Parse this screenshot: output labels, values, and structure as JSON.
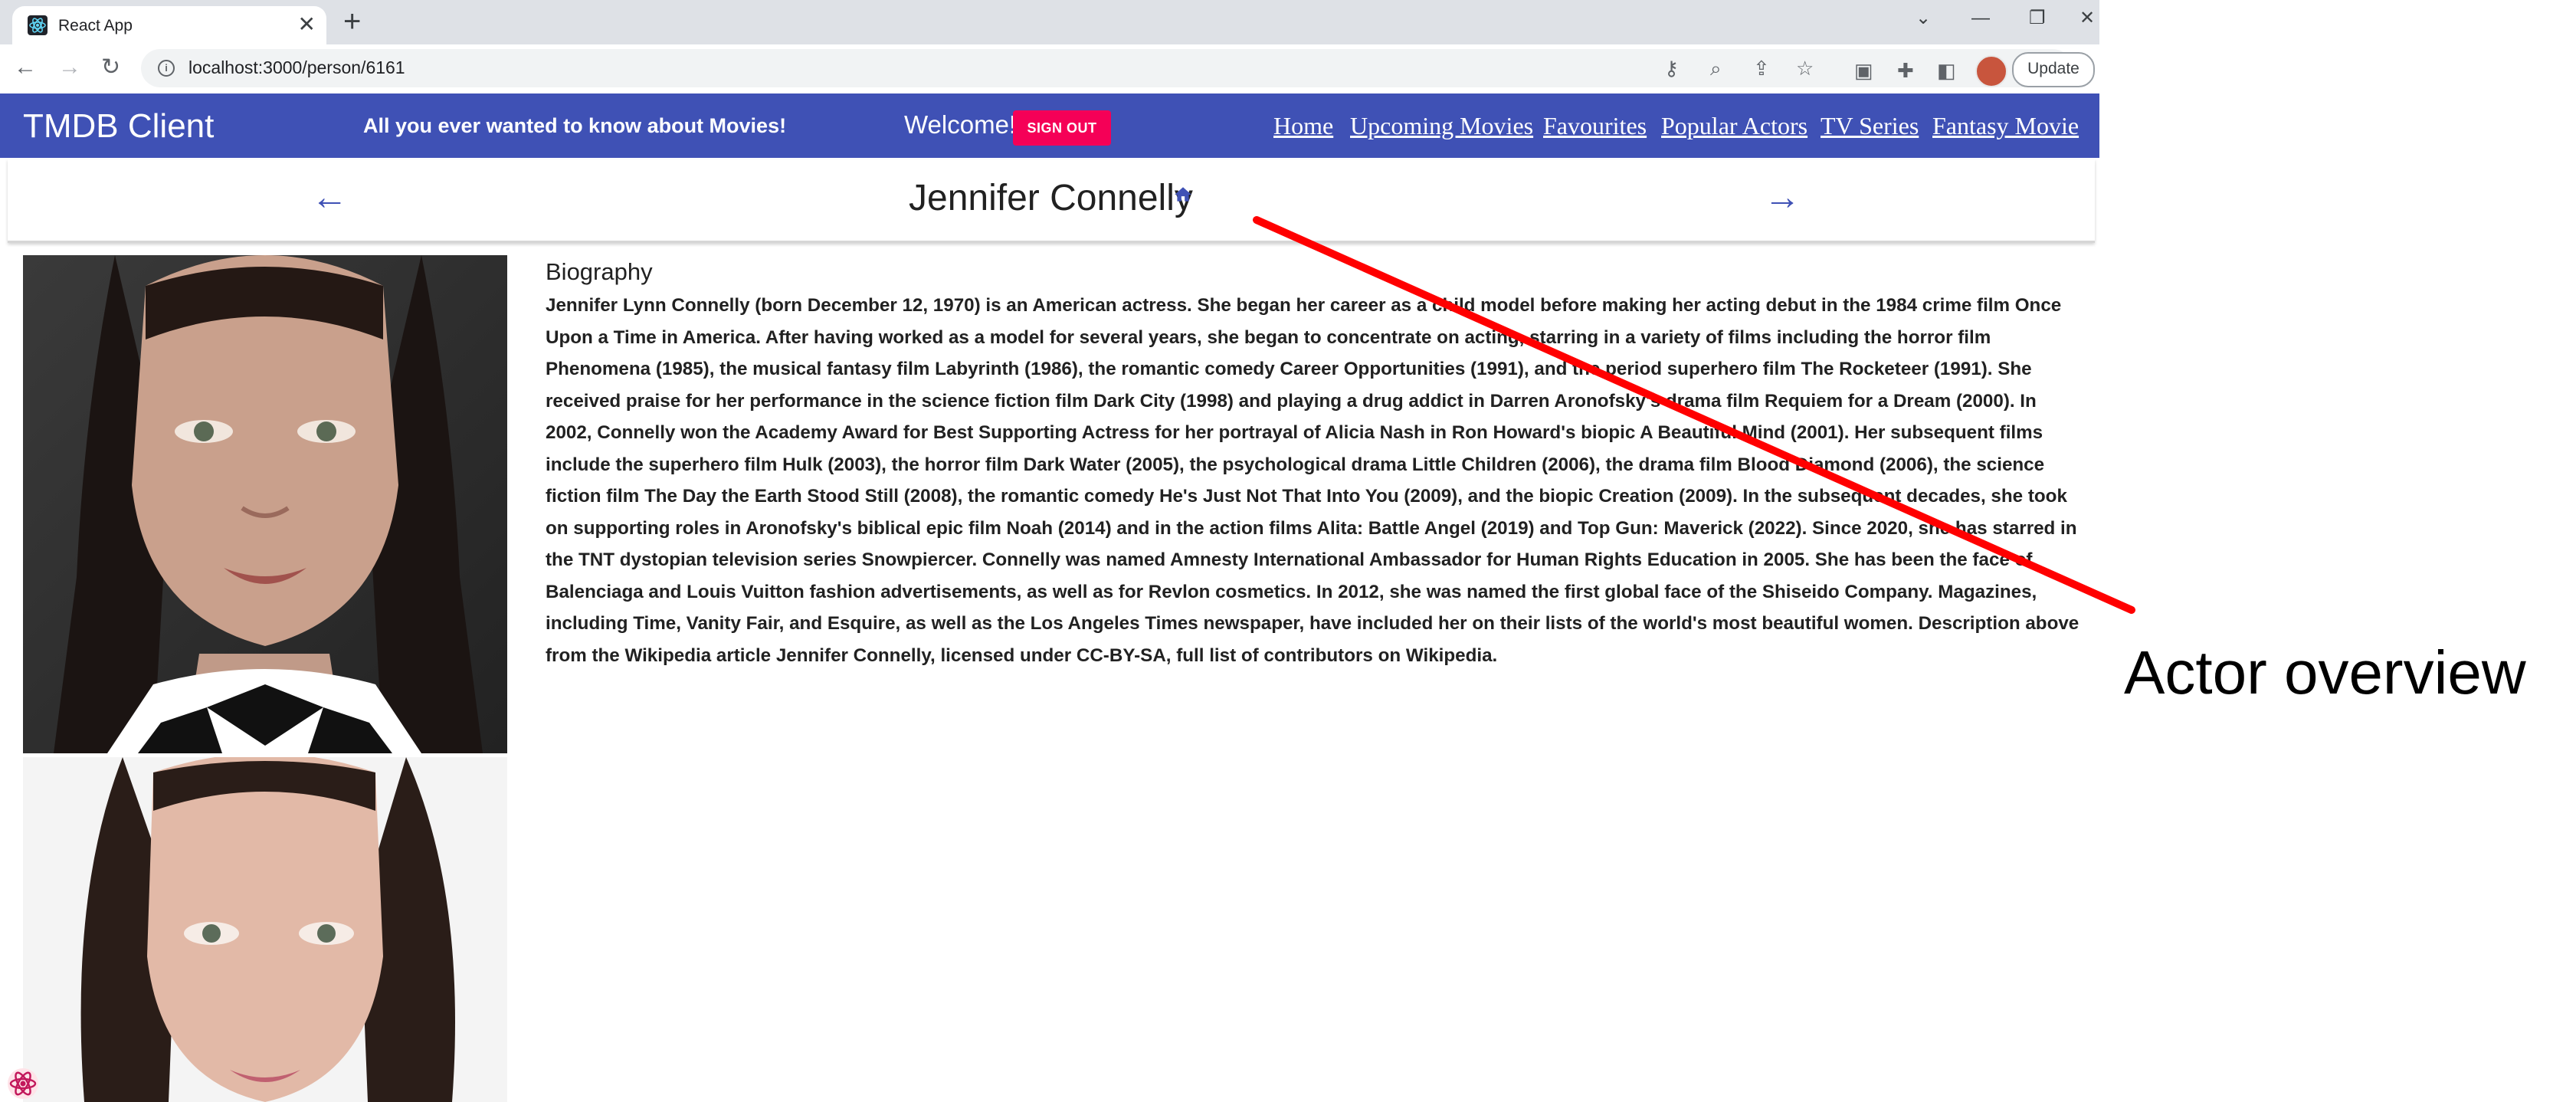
{
  "browser": {
    "tab_title": "React App",
    "tab_close": "✕",
    "new_tab": "+",
    "url": "localhost:3000/person/6161",
    "update_label": "Update",
    "window_controls": [
      "⌄",
      "—",
      "❐",
      "✕"
    ]
  },
  "header": {
    "app_title": "TMDB Client",
    "tagline": "All you ever wanted to know about Movies!",
    "welcome": "Welcome!",
    "signout_label": "SIGN OUT",
    "nav": [
      "Home",
      "Upcoming Movies",
      "Favourites",
      "Popular Actors",
      "TV Series",
      "Fantasy Movie"
    ]
  },
  "person": {
    "name": "Jennifer Connelly",
    "prev_arrow": "←",
    "next_arrow": "→"
  },
  "biography": {
    "heading": "Biography",
    "text": "Jennifer Lynn Connelly (born December 12, 1970) is an American actress. She began her career as a child model before making her acting debut in the 1984 crime film Once Upon a Time in America. After having worked as a model for several years, she began to concentrate on acting, starring in a variety of films including the horror film Phenomena (1985), the musical fantasy film Labyrinth (1986), the romantic comedy Career Opportunities (1991), and the period superhero film The Rocketeer (1991). She received praise for her performance in the science fiction film Dark City (1998) and playing a drug addict in Darren Aronofsky's drama film Requiem for a Dream (2000). In 2002, Connelly won the Academy Award for Best Supporting Actress for her portrayal of Alicia Nash in Ron Howard's biopic A Beautiful Mind (2001). Her subsequent films include the superhero film Hulk (2003), the horror film Dark Water (2005), the psychological drama Little Children (2006), the drama film Blood Diamond (2006), the science fiction film The Day the Earth Stood Still (2008), the romantic comedy He's Just Not That Into You (2009), and the biopic Creation (2009). In the subsequent decades, she took on supporting roles in Aronofsky's biblical epic film Noah (2014) and in the action films Alita: Battle Angel (2019) and Top Gun: Maverick (2022). Since 2020, she has starred in the TNT dystopian television series Snowpiercer. Connelly was named Amnesty International Ambassador for Human Rights Education in 2005. She has been the face of Balenciaga and Louis Vuitton fashion advertisements, as well as for Revlon cosmetics. In 2012, she was named the first global face of the Shiseido Company. Magazines, including Time, Vanity Fair, and Esquire, as well as the Los Angeles Times newspaper, have included her on their lists of the world's most beautiful women. Description above from the Wikipedia article Jennifer Connelly, licensed under CC-BY-SA, full list of contributors on Wikipedia."
  },
  "annotation": {
    "label": "Actor overview",
    "color": "#ff0000"
  },
  "colors": {
    "primary": "#3f51b5",
    "secondary": "#f50057"
  }
}
